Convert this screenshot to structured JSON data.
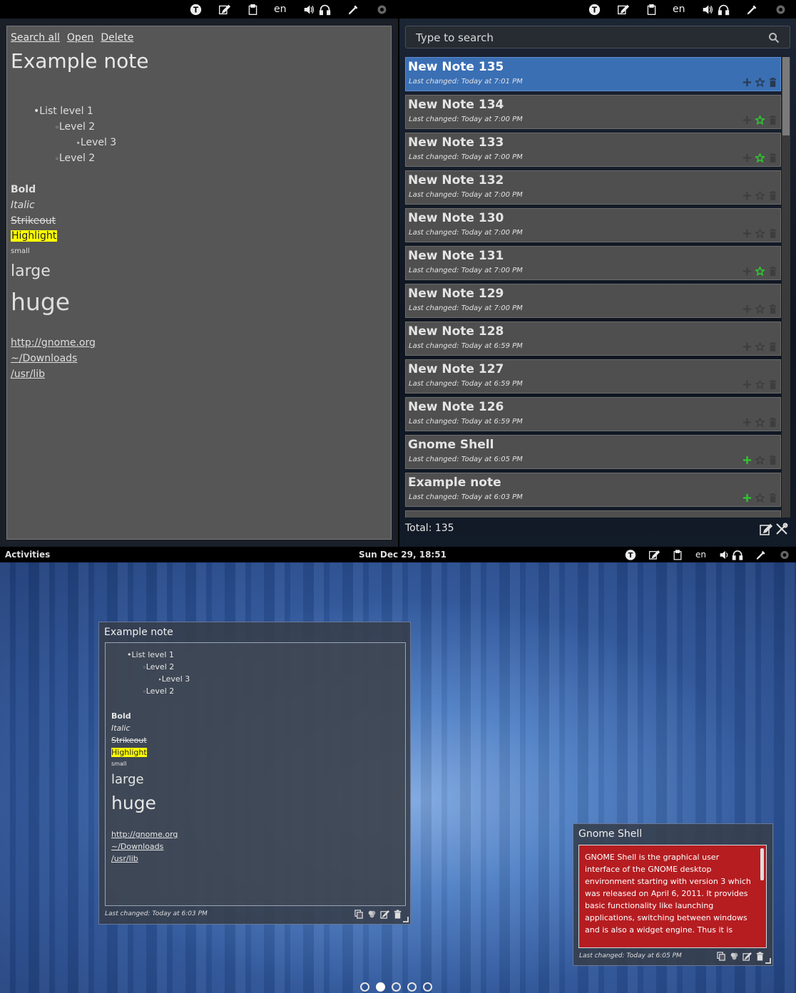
{
  "top_tray": {
    "lang": "en"
  },
  "note_view": {
    "links": [
      "Search all",
      "Open",
      "Delete"
    ],
    "title": "Example note",
    "list": [
      "List level 1",
      "Level 2",
      "Level 3",
      "Level 2"
    ],
    "bullets": [
      "•",
      "◦",
      "‣",
      "◦"
    ],
    "bold": "Bold",
    "italic": "Italic",
    "strikeout": "Strikeout",
    "highlight": "Highlight",
    "small": "small",
    "large": "large",
    "huge": "huge",
    "urls": [
      "http://gnome.org",
      "~/Downloads",
      "/usr/lib"
    ]
  },
  "notes_list": {
    "search_placeholder": "Type to search",
    "date_prefix": "Last changed:",
    "notes": [
      {
        "title": "New Note 135",
        "date": "Today at 7:01 PM",
        "starred": false,
        "selected": true,
        "plus_green": false
      },
      {
        "title": "New Note 134",
        "date": "Today at 7:00 PM",
        "starred": true,
        "selected": false,
        "plus_green": false
      },
      {
        "title": "New Note 133",
        "date": "Today at 7:00 PM",
        "starred": true,
        "selected": false,
        "plus_green": false
      },
      {
        "title": "New Note 132",
        "date": "Today at 7:00 PM",
        "starred": false,
        "selected": false,
        "plus_green": false
      },
      {
        "title": "New Note 130",
        "date": "Today at 7:00 PM",
        "starred": false,
        "selected": false,
        "plus_green": false
      },
      {
        "title": "New Note 131",
        "date": "Today at 7:00 PM",
        "starred": true,
        "selected": false,
        "plus_green": false
      },
      {
        "title": "New Note 129",
        "date": "Today at 7:00 PM",
        "starred": false,
        "selected": false,
        "plus_green": false
      },
      {
        "title": "New Note 128",
        "date": "Today at 6:59 PM",
        "starred": false,
        "selected": false,
        "plus_green": false
      },
      {
        "title": "New Note 127",
        "date": "Today at 6:59 PM",
        "starred": false,
        "selected": false,
        "plus_green": false
      },
      {
        "title": "New Note 126",
        "date": "Today at 6:59 PM",
        "starred": false,
        "selected": false,
        "plus_green": false
      },
      {
        "title": "Gnome Shell",
        "date": "Today at 6:05 PM",
        "starred": false,
        "selected": false,
        "plus_green": true
      },
      {
        "title": "Example note",
        "date": "Today at 6:03 PM",
        "starred": false,
        "selected": false,
        "plus_green": true
      }
    ],
    "total_label": "Total: 135"
  },
  "shell_bar": {
    "activities": "Activities",
    "clock": "Sun Dec 29, 18:51",
    "lang": "en"
  },
  "desktop_note_example": {
    "title": "Example note",
    "date": "Last changed: Today at 6:03 PM"
  },
  "desktop_note_gnome": {
    "title": "Gnome Shell",
    "body": "GNOME Shell is the graphical user interface of the GNOME desktop environment starting with version 3 which was released on April 6, 2011. It provides basic functionality like launching applications, switching between windows and is also a widget engine. Thus it is",
    "date": "Last changed: Today at 6:05 PM"
  },
  "workspaces": {
    "count": 5,
    "active": 1
  },
  "colors": {
    "selection": "#3a6fb4",
    "star_active": "#2ecc2e",
    "highlight": "#ffff00",
    "gnome_note_bg": "#b51d21"
  }
}
